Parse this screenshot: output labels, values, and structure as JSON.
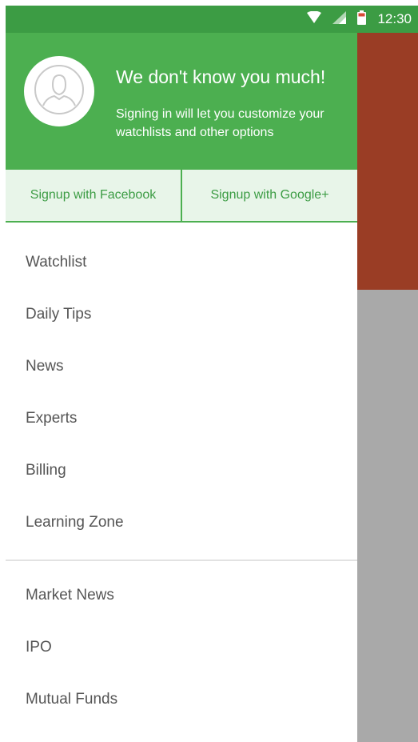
{
  "status_bar": {
    "time": "12:30",
    "icons": [
      "wifi-icon",
      "signal-icon",
      "battery-icon"
    ]
  },
  "drawer": {
    "header": {
      "avatar_icon": "user-avatar-icon",
      "title": "We don't know you much!",
      "subtitle": "Signing in will let you customize your watchlists and other options"
    },
    "signup": {
      "facebook_label": "Signup with Facebook",
      "google_label": "Signup with Google+"
    },
    "menu_primary": [
      "Watchlist",
      "Daily Tips",
      "News",
      "Experts",
      "Billing",
      "Learning Zone"
    ],
    "menu_secondary": [
      "Market News",
      "IPO",
      "Mutual Funds"
    ]
  },
  "colors": {
    "header_green": "#4caf50",
    "status_bar_green": "#3c9c44",
    "signup_bg": "#e8f5e9",
    "background_app_header": "#9a3d25",
    "scrim_gray": "#a9a9a9"
  }
}
